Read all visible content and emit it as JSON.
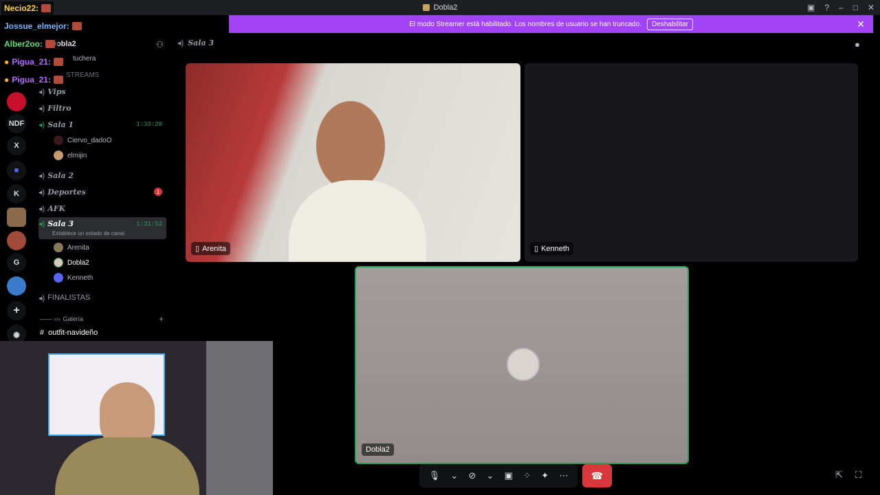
{
  "window": {
    "title": "Dobla2"
  },
  "banner": {
    "message": "El modo Streamer está habilitado. Los nombres de usuario se han truncado.",
    "button_label": "Deshabilitar"
  },
  "servers": [
    "NDF",
    "X",
    "K",
    "G"
  ],
  "server_header": {
    "name": "Dobla2",
    "channel_label": "tuchera",
    "category": "STREAMS"
  },
  "channels": [
    {
      "name": "Vips"
    },
    {
      "name": "Filtro"
    },
    {
      "name": "Sala 1",
      "time": "1:33:28"
    },
    {
      "name": "Sala 2"
    },
    {
      "name": "Deportes",
      "badge": "1"
    },
    {
      "name": "AFK"
    },
    {
      "name": "Sala 3",
      "time": "1:31:52",
      "status": "Establece un estado de canal"
    }
  ],
  "sala1_users": [
    "Ciervo_dadoO",
    "elmijin"
  ],
  "sala3_users": [
    "Arenita",
    "Dobla2",
    "Kenneth"
  ],
  "finalistas": "FINALISTAS",
  "gallery": {
    "label": "Galería",
    "prefix": "—— ›››",
    "text_channel": "outfit-navideño"
  },
  "call_header": {
    "channel": "Sala 3"
  },
  "tiles": [
    {
      "label": "Arenita"
    },
    {
      "label": "Kenneth"
    },
    {
      "label": "Dobla2"
    }
  ],
  "chat_overlay": [
    {
      "user": "Necio22:",
      "color": "#ffd24a"
    },
    {
      "user": "Jossue_elmejor:",
      "color": "#7ab6ff"
    },
    {
      "user": "Alber2oo:",
      "color": "#5fe07a"
    },
    {
      "user": "Pigua_21:",
      "color": "#b36bff"
    },
    {
      "user": "Pigua_21:",
      "color": "#b36bff"
    }
  ],
  "colors": {
    "accent": "#a142f4",
    "hangup": "#da373c",
    "speaking": "#23a55a"
  }
}
